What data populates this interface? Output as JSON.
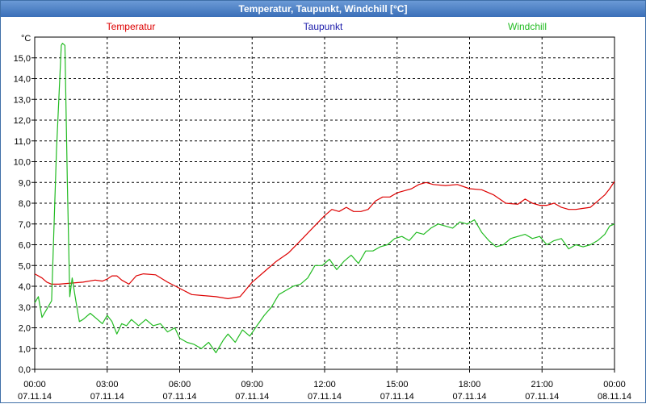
{
  "window": {
    "title": "Temperatur, Taupunkt, Windchill [°C]"
  },
  "chart_data": {
    "type": "line",
    "title": "Temperatur, Taupunkt, Windchill [°C]",
    "ylabel": "°C",
    "ylim": [
      0,
      16
    ],
    "xlim_hours": [
      0,
      24
    ],
    "grid": true,
    "yticks": [
      "0,0",
      "1,0",
      "2,0",
      "3,0",
      "4,0",
      "5,0",
      "6,0",
      "7,0",
      "8,0",
      "9,0",
      "10,0",
      "11,0",
      "12,0",
      "13,0",
      "14,0",
      "15,0"
    ],
    "xticks": [
      {
        "time": "00:00",
        "date": "07.11.14"
      },
      {
        "time": "03:00",
        "date": "07.11.14"
      },
      {
        "time": "06:00",
        "date": "07.11.14"
      },
      {
        "time": "09:00",
        "date": "07.11.14"
      },
      {
        "time": "12:00",
        "date": "07.11.14"
      },
      {
        "time": "15:00",
        "date": "07.11.14"
      },
      {
        "time": "18:00",
        "date": "07.11.14"
      },
      {
        "time": "21:00",
        "date": "07.11.14"
      },
      {
        "time": "00:00",
        "date": "08.11.14"
      }
    ],
    "series": [
      {
        "name": "Temperatur",
        "color": "#dd0000",
        "legend_anchor": "left",
        "x": [
          0,
          0.3,
          0.5,
          0.7,
          1,
          1.5,
          2,
          2.5,
          2.8,
          3,
          3.2,
          3.4,
          3.6,
          3.9,
          4.2,
          4.5,
          5,
          5.5,
          6,
          6.5,
          7,
          7.5,
          8,
          8.5,
          9,
          9.5,
          10,
          10.5,
          11,
          11.5,
          12,
          12.3,
          12.6,
          12.9,
          13.2,
          13.5,
          13.8,
          14.1,
          14.4,
          14.7,
          15,
          15.3,
          15.6,
          15.9,
          16.2,
          16.5,
          17,
          17.5,
          18,
          18.5,
          19,
          19.5,
          20,
          20.3,
          20.6,
          20.9,
          21.2,
          21.5,
          21.8,
          22.1,
          22.4,
          22.7,
          23,
          23.3,
          23.6,
          23.8,
          24
        ],
        "values": [
          4.6,
          4.4,
          4.2,
          4.1,
          4.1,
          4.15,
          4.2,
          4.3,
          4.25,
          4.35,
          4.5,
          4.5,
          4.3,
          4.1,
          4.5,
          4.6,
          4.55,
          4.2,
          3.9,
          3.6,
          3.55,
          3.5,
          3.4,
          3.5,
          4.2,
          4.7,
          5.2,
          5.6,
          6.2,
          6.8,
          7.4,
          7.7,
          7.6,
          7.8,
          7.6,
          7.6,
          7.7,
          8.1,
          8.3,
          8.3,
          8.5,
          8.6,
          8.7,
          8.9,
          9.0,
          8.9,
          8.85,
          8.9,
          8.7,
          8.65,
          8.4,
          8.0,
          7.95,
          8.2,
          8.0,
          7.9,
          7.9,
          8.0,
          7.8,
          7.7,
          7.7,
          7.75,
          7.8,
          8.1,
          8.4,
          8.7,
          9.05
        ]
      },
      {
        "name": "Taupunkt",
        "color": "#1a1aaa",
        "legend_anchor": "middle",
        "x": [],
        "values": []
      },
      {
        "name": "Windchill",
        "color": "#22bb22",
        "legend_anchor": "right",
        "x": [
          0,
          0.15,
          0.3,
          0.5,
          0.7,
          0.9,
          1.1,
          1.15,
          1.25,
          1.35,
          1.45,
          1.55,
          1.7,
          1.85,
          2,
          2.3,
          2.6,
          2.8,
          3,
          3.2,
          3.4,
          3.6,
          3.8,
          4,
          4.3,
          4.6,
          4.9,
          5.2,
          5.5,
          5.8,
          6,
          6.3,
          6.6,
          6.9,
          7.2,
          7.5,
          7.8,
          8,
          8.3,
          8.6,
          8.9,
          9.2,
          9.5,
          9.8,
          10.1,
          10.4,
          10.7,
          11,
          11.3,
          11.6,
          11.9,
          12.2,
          12.5,
          12.8,
          13.1,
          13.4,
          13.7,
          14,
          14.3,
          14.6,
          14.9,
          15.2,
          15.5,
          15.8,
          16.1,
          16.4,
          16.7,
          17,
          17.3,
          17.6,
          17.9,
          18.2,
          18.5,
          18.8,
          19.1,
          19.4,
          19.7,
          20,
          20.3,
          20.6,
          20.9,
          21.2,
          21.5,
          21.8,
          22.1,
          22.4,
          22.7,
          23,
          23.3,
          23.6,
          23.8,
          24
        ],
        "values": [
          3.2,
          3.5,
          2.5,
          2.9,
          3.3,
          10.5,
          15.6,
          15.7,
          15.6,
          9.0,
          3.5,
          4.4,
          3.3,
          2.3,
          2.4,
          2.7,
          2.4,
          2.2,
          2.6,
          2.3,
          1.7,
          2.2,
          2.1,
          2.4,
          2.1,
          2.4,
          2.1,
          2.2,
          1.8,
          2.0,
          1.5,
          1.3,
          1.2,
          1.0,
          1.3,
          0.8,
          1.4,
          1.7,
          1.3,
          1.9,
          1.6,
          2.1,
          2.6,
          3.0,
          3.6,
          3.8,
          4.0,
          4.1,
          4.4,
          5.0,
          5.0,
          5.3,
          4.8,
          5.2,
          5.5,
          5.1,
          5.7,
          5.7,
          5.9,
          6.0,
          6.3,
          6.4,
          6.2,
          6.6,
          6.5,
          6.8,
          7.0,
          6.9,
          6.8,
          7.1,
          7.0,
          7.2,
          6.6,
          6.2,
          5.9,
          6.0,
          6.3,
          6.4,
          6.5,
          6.3,
          6.4,
          6.0,
          6.2,
          6.3,
          5.8,
          6.0,
          5.9,
          6.0,
          6.2,
          6.5,
          6.9,
          7.0
        ]
      }
    ]
  }
}
